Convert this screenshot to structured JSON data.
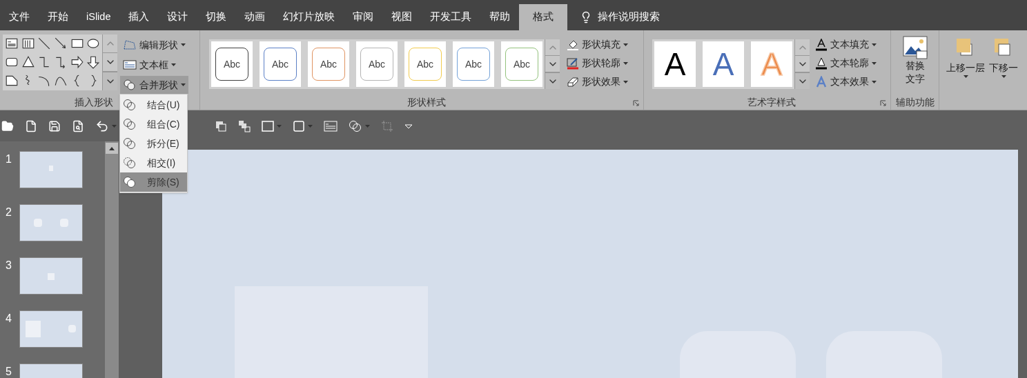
{
  "tabs": [
    {
      "label": "文件",
      "selected": false
    },
    {
      "label": "开始",
      "selected": false
    },
    {
      "label": "iSlide",
      "selected": false
    },
    {
      "label": "插入",
      "selected": false
    },
    {
      "label": "设计",
      "selected": false
    },
    {
      "label": "切换",
      "selected": false
    },
    {
      "label": "动画",
      "selected": false
    },
    {
      "label": "幻灯片放映",
      "selected": false
    },
    {
      "label": "审阅",
      "selected": false
    },
    {
      "label": "视图",
      "selected": false
    },
    {
      "label": "开发工具",
      "selected": false
    },
    {
      "label": "帮助",
      "selected": false
    },
    {
      "label": "格式",
      "selected": true
    }
  ],
  "tell_me": "操作说明搜索",
  "insert_shapes": {
    "label": "插入形状",
    "buttons": [
      {
        "label": "编辑形状",
        "selected": false
      },
      {
        "label": "文本框",
        "selected": false
      },
      {
        "label": "合并形状",
        "selected": true
      }
    ]
  },
  "shape_styles": {
    "label": "形状样式",
    "styles": [
      {
        "text": "Abc",
        "color": "#404040"
      },
      {
        "text": "Abc",
        "color": "#5b80c6"
      },
      {
        "text": "Abc",
        "color": "#e09462"
      },
      {
        "text": "Abc",
        "color": "#b4b4b4"
      },
      {
        "text": "Abc",
        "color": "#f2cc4e"
      },
      {
        "text": "Abc",
        "color": "#74a2d8"
      },
      {
        "text": "Abc",
        "color": "#94c27e"
      }
    ],
    "buttons": [
      "形状填充",
      "形状轮廓",
      "形状效果"
    ]
  },
  "wordart_styles": {
    "label": "艺术字样式",
    "styles": [
      {
        "text": "A",
        "kind": "solid",
        "color": "#000000"
      },
      {
        "text": "A",
        "kind": "solid",
        "color": "#4a6fb8"
      },
      {
        "text": "A",
        "kind": "outline",
        "color": "#ec8a4a"
      }
    ],
    "buttons": [
      "文本填充",
      "文本轮廓",
      "文本效果"
    ]
  },
  "accessibility": {
    "label": "辅助功能",
    "button": [
      "替换",
      "文字"
    ]
  },
  "arrange": {
    "buttons": [
      "上移一层",
      "下移一"
    ]
  },
  "merge_menu": [
    {
      "label": "结合(U)",
      "selected": false
    },
    {
      "label": "组合(C)",
      "selected": false
    },
    {
      "label": "拆分(E)",
      "selected": false
    },
    {
      "label": "相交(I)",
      "selected": false
    },
    {
      "label": "剪除(S)",
      "selected": true
    }
  ],
  "slides": [
    {
      "number": "1",
      "selected": false
    },
    {
      "number": "2",
      "selected": false
    },
    {
      "number": "3",
      "selected": false
    },
    {
      "number": "4",
      "selected": false
    },
    {
      "number": "5",
      "selected": false
    }
  ]
}
